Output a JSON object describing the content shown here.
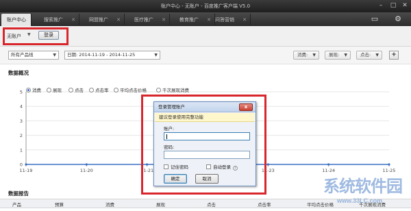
{
  "window": {
    "title": "账户中心 - 无账户 - 百度推广客户端 V5.0"
  },
  "tabs": [
    {
      "label": "账户中心",
      "active": true
    },
    {
      "label": "搜索推广",
      "active": false
    },
    {
      "label": "网盟推广",
      "active": false
    },
    {
      "label": "医疗推广",
      "active": false
    },
    {
      "label": "教育推广",
      "active": false
    },
    {
      "label": "问答营销",
      "active": false
    }
  ],
  "account": {
    "name": "无账户",
    "login_label": "登录"
  },
  "filters": {
    "product_line": "所有产品线",
    "date_range": "日期: 2014-11-19 - 2014-11-25",
    "metric1": "消费:",
    "metric2": "展现:",
    "metric3": "点击:",
    "add": "+"
  },
  "overview": {
    "title": "数据概况",
    "legend": [
      {
        "label": "消费",
        "selected": true
      },
      {
        "label": "展现",
        "selected": false
      },
      {
        "label": "点击",
        "selected": false
      },
      {
        "label": "点击率",
        "selected": false
      },
      {
        "label": "平均点击价格",
        "selected": false
      },
      {
        "label": "千次展现消费",
        "selected": false
      }
    ]
  },
  "chart_data": {
    "type": "line",
    "x": [
      "11-19",
      "11-20",
      "11-21",
      "11-22",
      "11-23",
      "11-24",
      "11-25"
    ],
    "series": [
      {
        "values": [
          0,
          0,
          0,
          0,
          0,
          0,
          0
        ]
      }
    ],
    "yticks": [
      "0",
      "1",
      "2",
      "3",
      "4",
      "5"
    ],
    "ylim": [
      0,
      5
    ],
    "grid": true,
    "color": "#3a6fc4"
  },
  "report": {
    "title": "数据报告",
    "columns": [
      "产品",
      "预算",
      "消费",
      "展现",
      "点击",
      "点击率",
      "平均点击价格",
      "千次展现消费"
    ]
  },
  "dialog": {
    "title": "登录管理账户",
    "close": "x",
    "hint": "建议登录使用完整功能",
    "account_label": "账户:",
    "account_value": "",
    "password_label": "密码:",
    "password_value": "",
    "remember_label": "记住密码",
    "autologin_label": "自动登录",
    "help": "?",
    "ok_label": "确定",
    "cancel_label": "取消"
  },
  "watermark": {
    "text": "系统软件园",
    "url": "www.33LC.com"
  }
}
